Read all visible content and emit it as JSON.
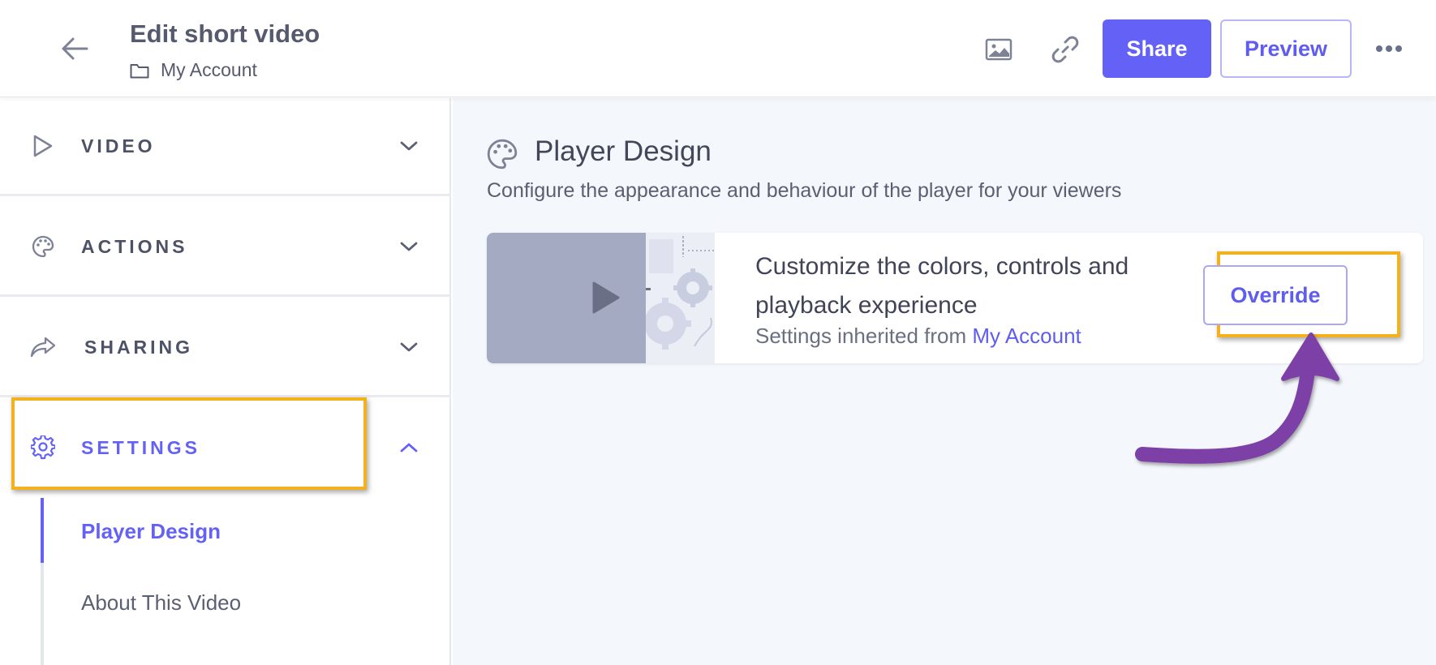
{
  "header": {
    "title": "Edit short video",
    "folder_label": "My Account",
    "share_label": "Share",
    "preview_label": "Preview"
  },
  "sidebar": {
    "sections": [
      {
        "label": "VIDEO",
        "icon": "play-icon",
        "expanded": false
      },
      {
        "label": "ACTIONS",
        "icon": "palette-icon",
        "expanded": false
      },
      {
        "label": "SHARING",
        "icon": "share-arrow-icon",
        "expanded": false
      },
      {
        "label": "SETTINGS",
        "icon": "gear-icon",
        "expanded": true
      }
    ],
    "sub_items": [
      {
        "label": "Player Design",
        "active": true
      },
      {
        "label": "About This Video",
        "active": false
      }
    ]
  },
  "main": {
    "title": "Player Design",
    "description": "Configure the appearance and behaviour of the player for your viewers",
    "card": {
      "headline": "Customize the colors, controls and playback experience",
      "inherited_prefix": "Settings inherited from",
      "inherited_link": "My Account",
      "override_label": "Override"
    }
  },
  "colors": {
    "accent": "#6461f6",
    "highlight": "#f3b21d",
    "annotation_arrow": "#7b3fa6"
  }
}
